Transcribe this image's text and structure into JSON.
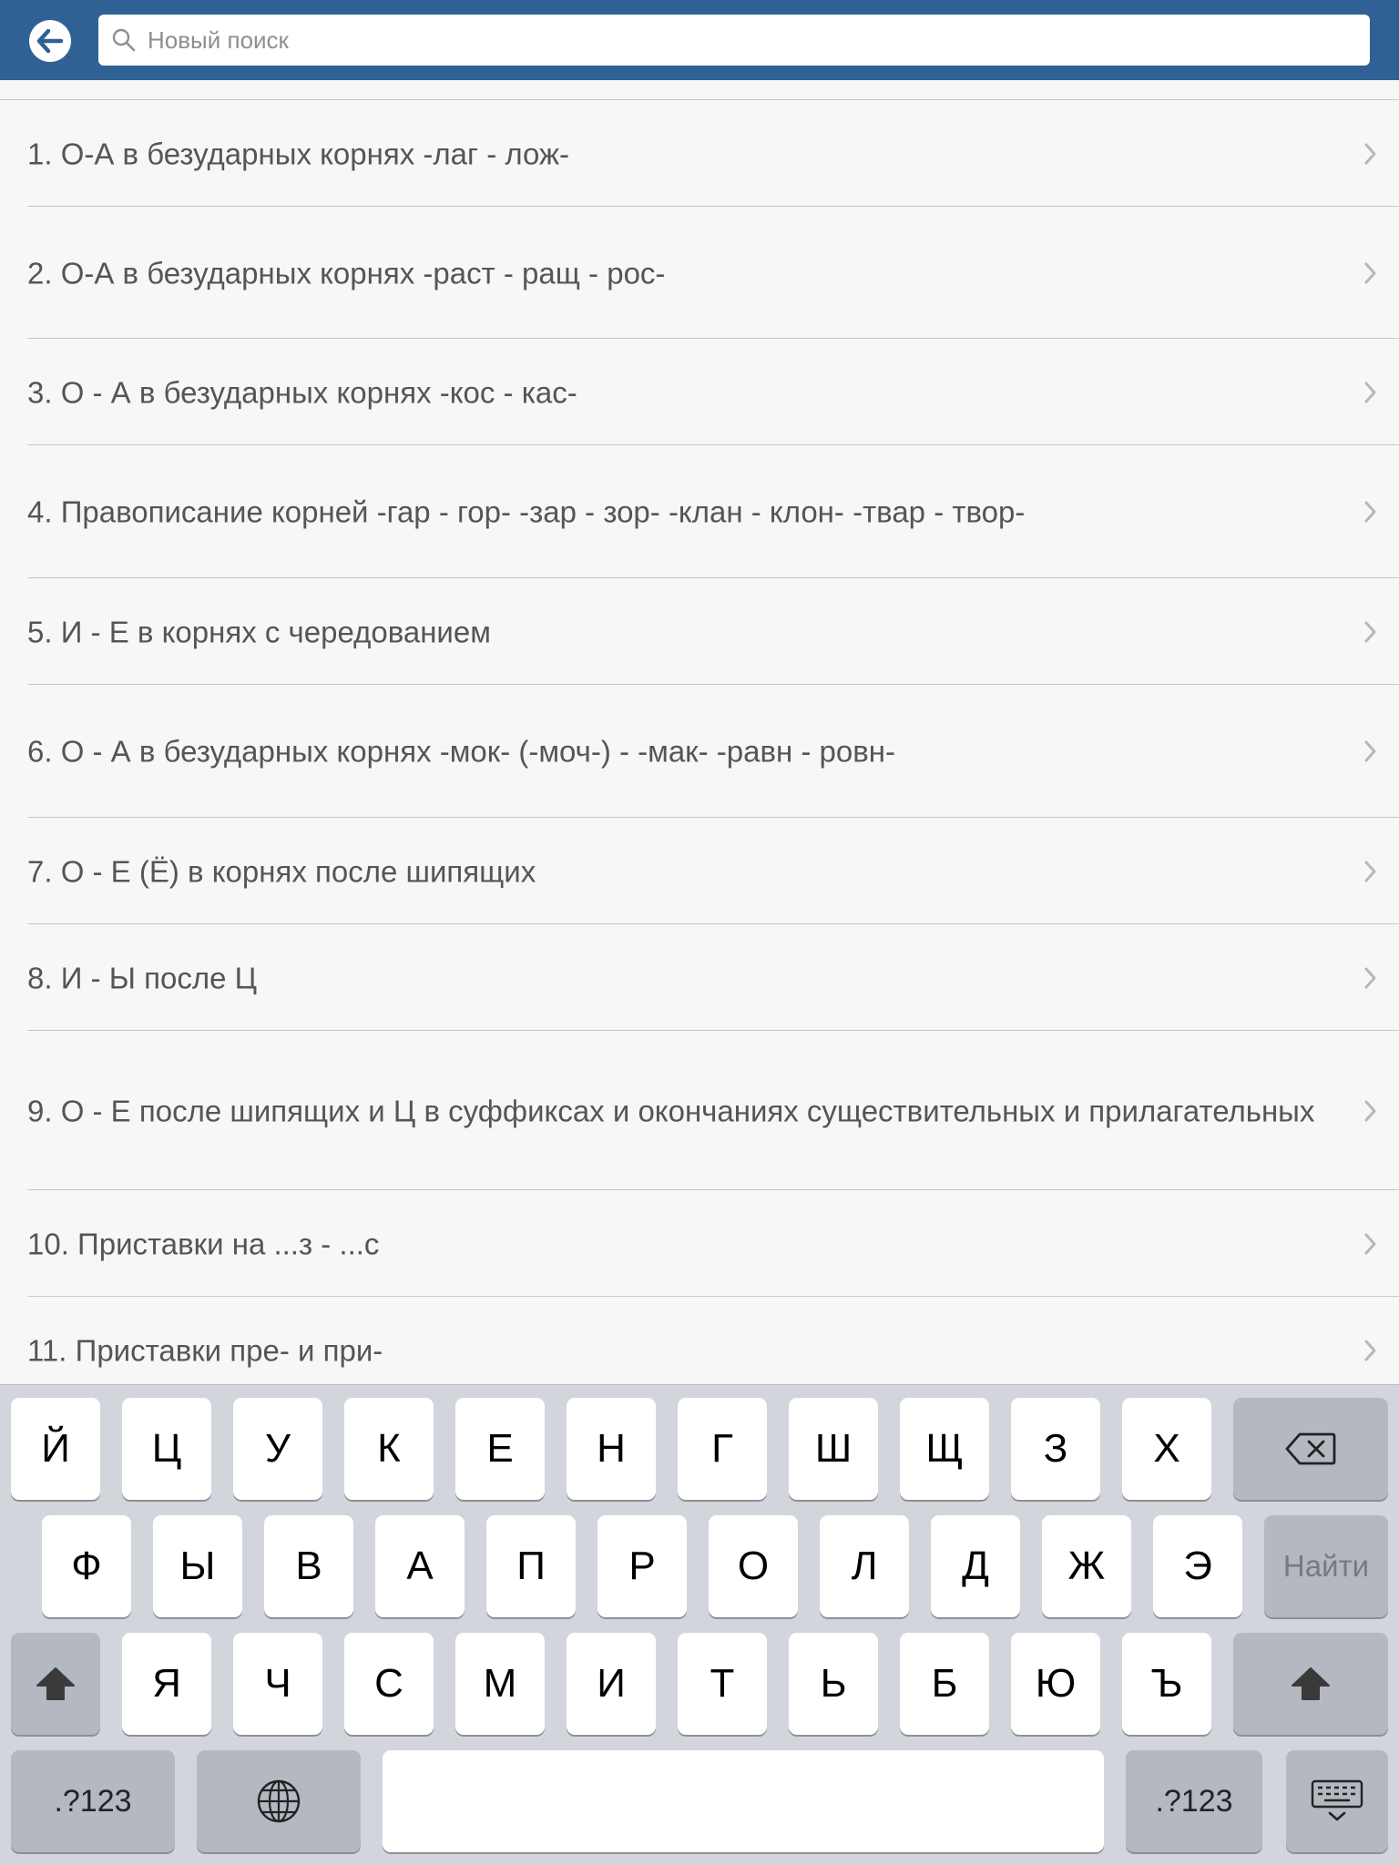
{
  "search": {
    "placeholder": "Новый поиск",
    "value": ""
  },
  "list": {
    "items": [
      {
        "label": "1. О-А в безударных корнях -лаг - лож-"
      },
      {
        "label": "2. О-А в безударных корнях -раст - ращ - рос-"
      },
      {
        "label": "3. О - А в безударных корнях -кос - кас-"
      },
      {
        "label": "4. Правописание корней -гар - гор- -зар - зор- -клан - клон- -твар - твор-"
      },
      {
        "label": "5. И - Е в корнях с чередованием"
      },
      {
        "label": "6. О - А в безударных корнях -мок- (-моч-) - -мак- -равн - ровн-"
      },
      {
        "label": "7. О - Е (Ё) в корнях после шипящих"
      },
      {
        "label": "8. И - Ы после Ц"
      },
      {
        "label": "9. О - Е после шипящих и Ц в суффиксах и окончаниях существительных и прилагательных"
      },
      {
        "label": "10. Приставки на ...з - ...с"
      },
      {
        "label": "11. Приставки пре- и при-"
      }
    ]
  },
  "keyboard": {
    "row1": [
      "Й",
      "Ц",
      "У",
      "К",
      "Е",
      "Н",
      "Г",
      "Ш",
      "Щ",
      "З",
      "Х"
    ],
    "row2": [
      "Ф",
      "Ы",
      "В",
      "А",
      "П",
      "Р",
      "О",
      "Л",
      "Д",
      "Ж",
      "Э"
    ],
    "row3": [
      "Я",
      "Ч",
      "С",
      "М",
      "И",
      "Т",
      "Ь",
      "Б",
      "Ю",
      "Ъ"
    ],
    "search_label": "Найти",
    "numbers_label": ".?123",
    "numbers_label_right": ".?123"
  },
  "colors": {
    "header": "#2f6195",
    "list_text": "#555555",
    "keyboard_bg": "#d2d5db"
  },
  "icons": {
    "back": "arrow-left-icon",
    "search": "search-icon",
    "chevron": "chevron-right-icon",
    "backspace": "backspace-icon",
    "shift": "shift-icon",
    "globe": "globe-icon",
    "hide_keyboard": "keyboard-hide-icon"
  }
}
